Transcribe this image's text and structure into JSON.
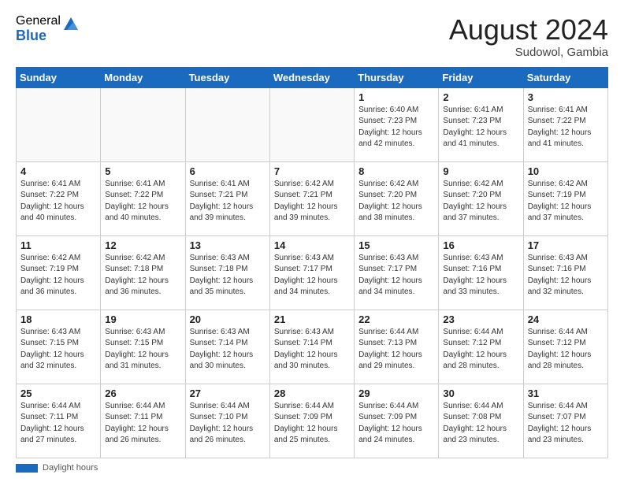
{
  "logo": {
    "general": "General",
    "blue": "Blue"
  },
  "title": "August 2024",
  "subtitle": "Sudowol, Gambia",
  "days_of_week": [
    "Sunday",
    "Monday",
    "Tuesday",
    "Wednesday",
    "Thursday",
    "Friday",
    "Saturday"
  ],
  "footer_label": "Daylight hours",
  "weeks": [
    [
      {
        "day": "",
        "info": ""
      },
      {
        "day": "",
        "info": ""
      },
      {
        "day": "",
        "info": ""
      },
      {
        "day": "",
        "info": ""
      },
      {
        "day": "1",
        "info": "Sunrise: 6:40 AM\nSunset: 7:23 PM\nDaylight: 12 hours\nand 42 minutes."
      },
      {
        "day": "2",
        "info": "Sunrise: 6:41 AM\nSunset: 7:23 PM\nDaylight: 12 hours\nand 41 minutes."
      },
      {
        "day": "3",
        "info": "Sunrise: 6:41 AM\nSunset: 7:22 PM\nDaylight: 12 hours\nand 41 minutes."
      }
    ],
    [
      {
        "day": "4",
        "info": "Sunrise: 6:41 AM\nSunset: 7:22 PM\nDaylight: 12 hours\nand 40 minutes."
      },
      {
        "day": "5",
        "info": "Sunrise: 6:41 AM\nSunset: 7:22 PM\nDaylight: 12 hours\nand 40 minutes."
      },
      {
        "day": "6",
        "info": "Sunrise: 6:41 AM\nSunset: 7:21 PM\nDaylight: 12 hours\nand 39 minutes."
      },
      {
        "day": "7",
        "info": "Sunrise: 6:42 AM\nSunset: 7:21 PM\nDaylight: 12 hours\nand 39 minutes."
      },
      {
        "day": "8",
        "info": "Sunrise: 6:42 AM\nSunset: 7:20 PM\nDaylight: 12 hours\nand 38 minutes."
      },
      {
        "day": "9",
        "info": "Sunrise: 6:42 AM\nSunset: 7:20 PM\nDaylight: 12 hours\nand 37 minutes."
      },
      {
        "day": "10",
        "info": "Sunrise: 6:42 AM\nSunset: 7:19 PM\nDaylight: 12 hours\nand 37 minutes."
      }
    ],
    [
      {
        "day": "11",
        "info": "Sunrise: 6:42 AM\nSunset: 7:19 PM\nDaylight: 12 hours\nand 36 minutes."
      },
      {
        "day": "12",
        "info": "Sunrise: 6:42 AM\nSunset: 7:18 PM\nDaylight: 12 hours\nand 36 minutes."
      },
      {
        "day": "13",
        "info": "Sunrise: 6:43 AM\nSunset: 7:18 PM\nDaylight: 12 hours\nand 35 minutes."
      },
      {
        "day": "14",
        "info": "Sunrise: 6:43 AM\nSunset: 7:17 PM\nDaylight: 12 hours\nand 34 minutes."
      },
      {
        "day": "15",
        "info": "Sunrise: 6:43 AM\nSunset: 7:17 PM\nDaylight: 12 hours\nand 34 minutes."
      },
      {
        "day": "16",
        "info": "Sunrise: 6:43 AM\nSunset: 7:16 PM\nDaylight: 12 hours\nand 33 minutes."
      },
      {
        "day": "17",
        "info": "Sunrise: 6:43 AM\nSunset: 7:16 PM\nDaylight: 12 hours\nand 32 minutes."
      }
    ],
    [
      {
        "day": "18",
        "info": "Sunrise: 6:43 AM\nSunset: 7:15 PM\nDaylight: 12 hours\nand 32 minutes."
      },
      {
        "day": "19",
        "info": "Sunrise: 6:43 AM\nSunset: 7:15 PM\nDaylight: 12 hours\nand 31 minutes."
      },
      {
        "day": "20",
        "info": "Sunrise: 6:43 AM\nSunset: 7:14 PM\nDaylight: 12 hours\nand 30 minutes."
      },
      {
        "day": "21",
        "info": "Sunrise: 6:43 AM\nSunset: 7:14 PM\nDaylight: 12 hours\nand 30 minutes."
      },
      {
        "day": "22",
        "info": "Sunrise: 6:44 AM\nSunset: 7:13 PM\nDaylight: 12 hours\nand 29 minutes."
      },
      {
        "day": "23",
        "info": "Sunrise: 6:44 AM\nSunset: 7:12 PM\nDaylight: 12 hours\nand 28 minutes."
      },
      {
        "day": "24",
        "info": "Sunrise: 6:44 AM\nSunset: 7:12 PM\nDaylight: 12 hours\nand 28 minutes."
      }
    ],
    [
      {
        "day": "25",
        "info": "Sunrise: 6:44 AM\nSunset: 7:11 PM\nDaylight: 12 hours\nand 27 minutes."
      },
      {
        "day": "26",
        "info": "Sunrise: 6:44 AM\nSunset: 7:11 PM\nDaylight: 12 hours\nand 26 minutes."
      },
      {
        "day": "27",
        "info": "Sunrise: 6:44 AM\nSunset: 7:10 PM\nDaylight: 12 hours\nand 26 minutes."
      },
      {
        "day": "28",
        "info": "Sunrise: 6:44 AM\nSunset: 7:09 PM\nDaylight: 12 hours\nand 25 minutes."
      },
      {
        "day": "29",
        "info": "Sunrise: 6:44 AM\nSunset: 7:09 PM\nDaylight: 12 hours\nand 24 minutes."
      },
      {
        "day": "30",
        "info": "Sunrise: 6:44 AM\nSunset: 7:08 PM\nDaylight: 12 hours\nand 23 minutes."
      },
      {
        "day": "31",
        "info": "Sunrise: 6:44 AM\nSunset: 7:07 PM\nDaylight: 12 hours\nand 23 minutes."
      }
    ]
  ]
}
